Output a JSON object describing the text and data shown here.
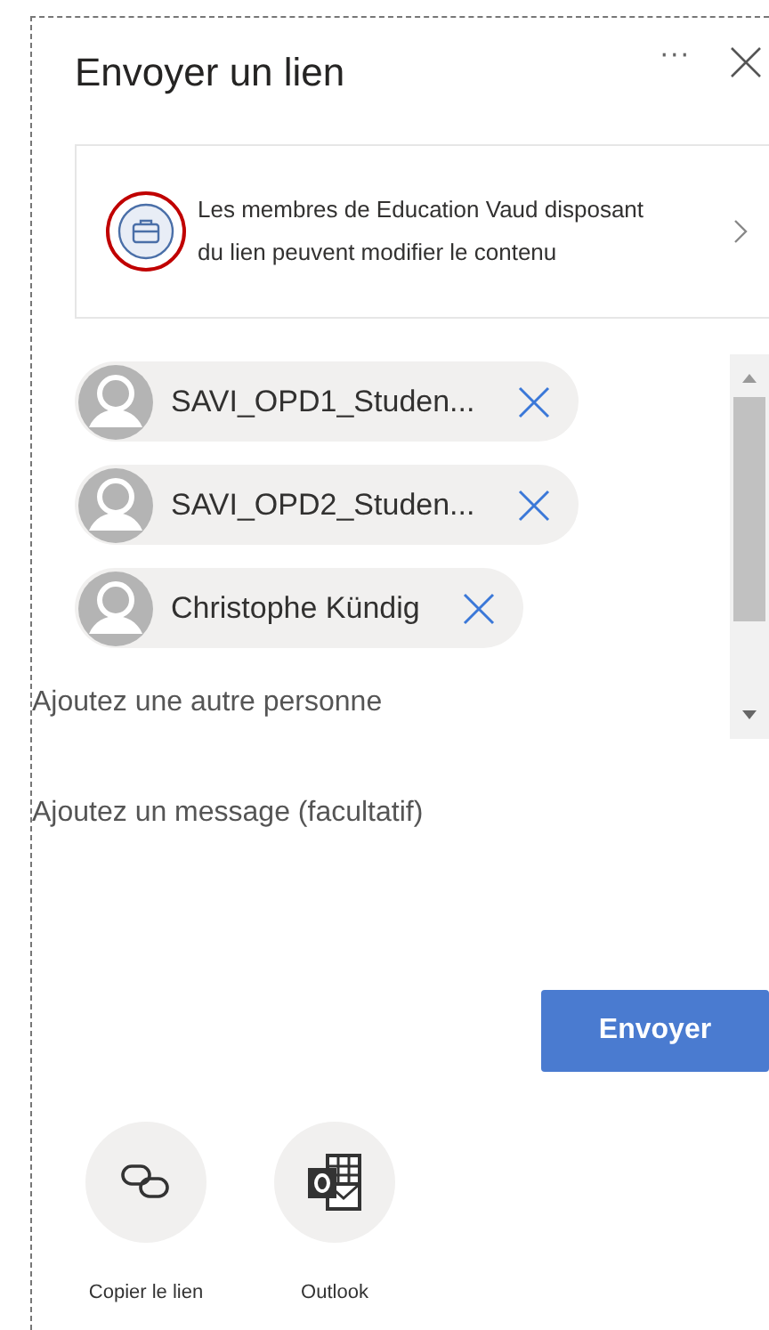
{
  "header": {
    "title": "Envoyer un lien",
    "more": "···"
  },
  "permission": {
    "text": "Les membres de Education Vaud disposant du lien peuvent modifier le contenu"
  },
  "recipients": [
    {
      "name": "SAVI_OPD1_Studen..."
    },
    {
      "name": "SAVI_OPD2_Studen..."
    },
    {
      "name": "Christophe Kündig"
    }
  ],
  "add_person": {
    "placeholder": "Ajoutez une autre personne"
  },
  "message": {
    "placeholder": "Ajoutez un message (facultatif)"
  },
  "send_button": "Envoyer",
  "share_options": [
    {
      "kind": "copy",
      "label": "Copier le lien"
    },
    {
      "kind": "outlook",
      "label": "Outlook"
    }
  ]
}
